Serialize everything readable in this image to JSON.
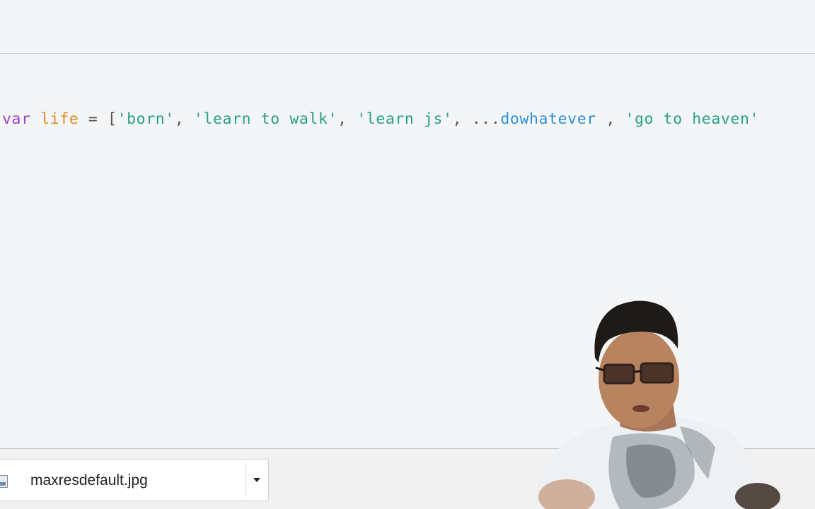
{
  "editor": {
    "code": {
      "keyword": "var",
      "variable": "life",
      "assign": " = ",
      "open_bracket": "[",
      "str1": "'born'",
      "sep1": ", ",
      "str2": "'learn to walk'",
      "sep2": ", ",
      "str3": "'learn js'",
      "sep3": ", ",
      "spread": "...",
      "spread_ident": "dowhatever",
      "sep4": " , ",
      "str4": "'go to heaven'"
    }
  },
  "download_bar": {
    "file_name": "maxresdefault.jpg",
    "file_icon": "image-file-icon",
    "menu_icon": "chevron-down-icon"
  },
  "webcam": {
    "description_icon": "presenter-video-overlay"
  }
}
